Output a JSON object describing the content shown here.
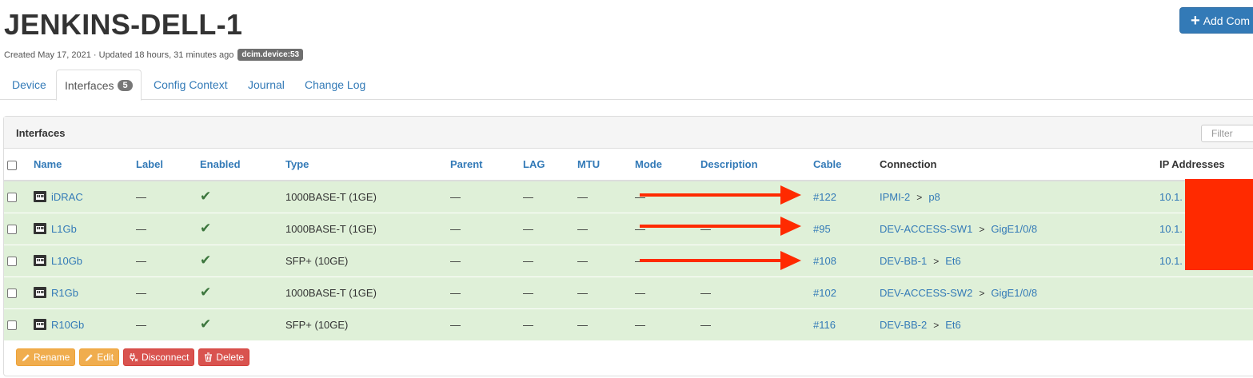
{
  "page": {
    "title": "JENKINS-DELL-1",
    "meta_text": "Created May 17, 2021 · Updated 18 hours, 31 minutes ago",
    "meta_badge": "dcim.device:53",
    "add_button_label": "Add Com"
  },
  "tabs": [
    {
      "label": "Device"
    },
    {
      "label": "Interfaces",
      "count": "5"
    },
    {
      "label": "Config Context"
    },
    {
      "label": "Journal"
    },
    {
      "label": "Change Log"
    }
  ],
  "panel": {
    "title": "Interfaces",
    "filter_placeholder": "Filter"
  },
  "table": {
    "headers": [
      "Name",
      "Label",
      "Enabled",
      "Type",
      "Parent",
      "LAG",
      "MTU",
      "Mode",
      "Description",
      "Cable",
      "Connection",
      "IP Addresses"
    ],
    "rows": [
      {
        "name": "iDRAC",
        "label": "—",
        "enabled": "✔",
        "type": "1000BASE-T (1GE)",
        "parent": "—",
        "lag": "—",
        "mtu": "—",
        "mode": "—",
        "description": "",
        "cable": "#122",
        "conn_device": "IPMI-2",
        "conn_port": "p8",
        "ip": "10.1."
      },
      {
        "name": "L1Gb",
        "label": "—",
        "enabled": "✔",
        "type": "1000BASE-T (1GE)",
        "parent": "—",
        "lag": "—",
        "mtu": "—",
        "mode": "—",
        "description": "—",
        "cable": "#95",
        "conn_device": "DEV-ACCESS-SW1",
        "conn_port": "GigE1/0/8",
        "ip": "10.1."
      },
      {
        "name": "L10Gb",
        "label": "—",
        "enabled": "✔",
        "type": "SFP+ (10GE)",
        "parent": "—",
        "lag": "—",
        "mtu": "—",
        "mode": "—",
        "description": "",
        "cable": "#108",
        "conn_device": "DEV-BB-1",
        "conn_port": "Et6",
        "ip": "10.1."
      },
      {
        "name": "R1Gb",
        "label": "—",
        "enabled": "✔",
        "type": "1000BASE-T (1GE)",
        "parent": "—",
        "lag": "—",
        "mtu": "—",
        "mode": "—",
        "description": "—",
        "cable": "#102",
        "conn_device": "DEV-ACCESS-SW2",
        "conn_port": "GigE1/0/8",
        "ip": ""
      },
      {
        "name": "R10Gb",
        "label": "—",
        "enabled": "✔",
        "type": "SFP+ (10GE)",
        "parent": "—",
        "lag": "—",
        "mtu": "—",
        "mode": "—",
        "description": "—",
        "cable": "#116",
        "conn_device": "DEV-BB-2",
        "conn_port": "Et6",
        "ip": ""
      }
    ]
  },
  "actions": {
    "rename": "Rename",
    "edit": "Edit",
    "disconnect": "Disconnect",
    "delete": "Delete"
  },
  "icons": {
    "port": "ethernet-port-icon",
    "plus": "plus-icon",
    "pencil": "pencil-icon",
    "unplug": "unplug-icon",
    "trash": "trash-icon",
    "check": "check-icon"
  },
  "colors": {
    "primary": "#337ab7",
    "success_row": "#dff0d8",
    "check": "#3c763d",
    "warning": "#f0ad4e",
    "danger": "#d9534f",
    "annotation": "#ff2a00"
  }
}
